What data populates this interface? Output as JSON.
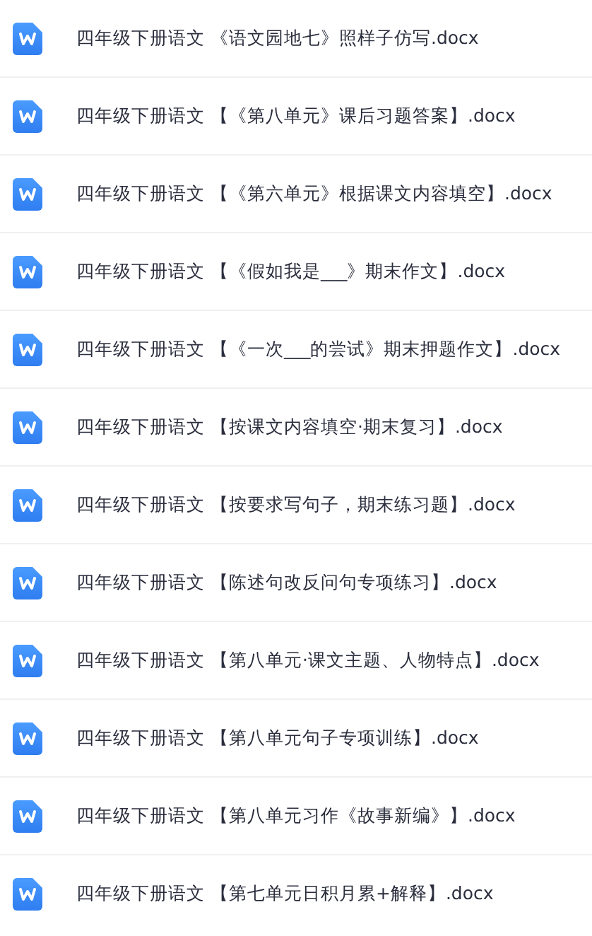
{
  "files": [
    {
      "name": "四年级下册语文 《语文园地七》照样子仿写.docx"
    },
    {
      "name": "四年级下册语文 【《第八单元》课后习题答案】.docx"
    },
    {
      "name": "四年级下册语文 【《第六单元》根据课文内容填空】.docx"
    },
    {
      "name": "四年级下册语文 【《假如我是___》期末作文】.docx"
    },
    {
      "name": "四年级下册语文 【《一次___的尝试》期末押题作文】.docx"
    },
    {
      "name": "四年级下册语文 【按课文内容填空·期末复习】.docx"
    },
    {
      "name": "四年级下册语文 【按要求写句子，期末练习题】.docx"
    },
    {
      "name": "四年级下册语文 【陈述句改反问句专项练习】.docx"
    },
    {
      "name": "四年级下册语文 【第八单元·课文主题、人物特点】.docx"
    },
    {
      "name": "四年级下册语文 【第八单元句子专项训练】.docx"
    },
    {
      "name": "四年级下册语文 【第八单元习作《故事新编》】.docx"
    },
    {
      "name": "四年级下册语文 【第七单元日积月累+解释】.docx"
    }
  ]
}
